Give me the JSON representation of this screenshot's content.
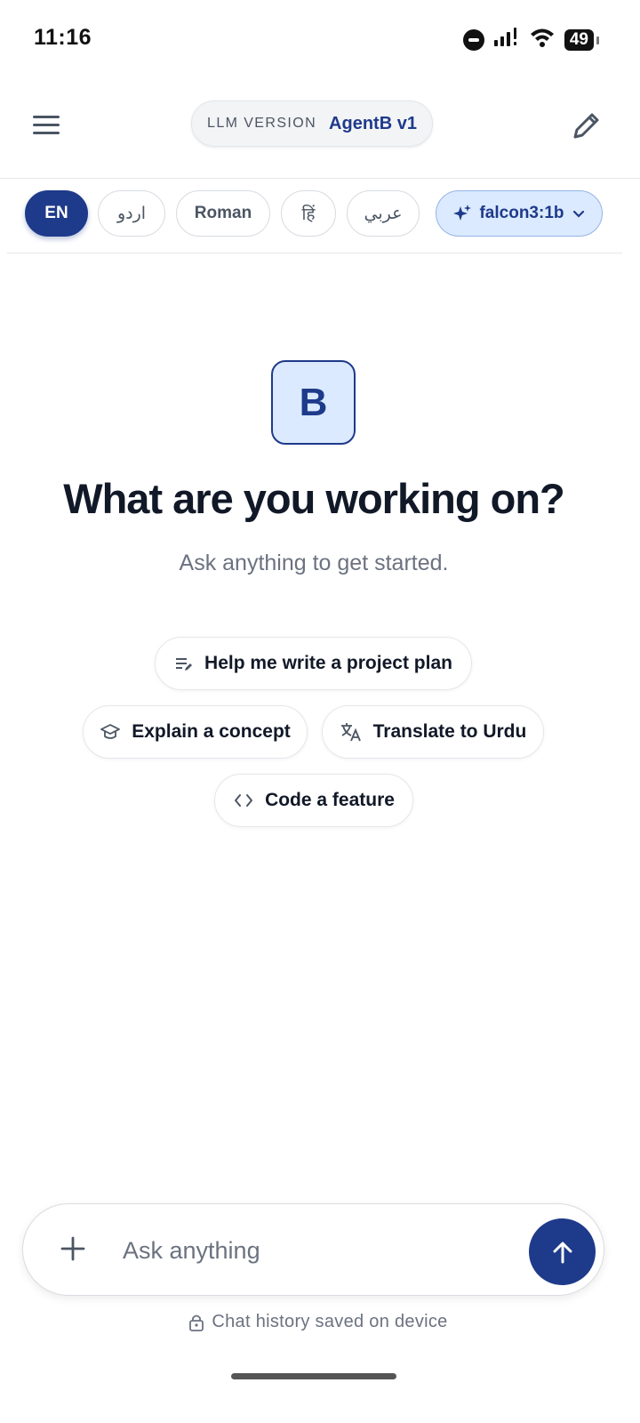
{
  "status_bar": {
    "time": "11:16",
    "battery": "49",
    "icons": [
      "do-not-disturb-icon",
      "signal-icon",
      "wifi-icon",
      "battery-icon"
    ]
  },
  "header": {
    "version_label": "LLM VERSION",
    "version_name": "AgentB v1",
    "menu_icon": "hamburger-menu-icon",
    "edit_icon": "pencil-icon"
  },
  "languages": {
    "items": [
      {
        "label": "EN",
        "active": true
      },
      {
        "label": "اردو",
        "active": false
      },
      {
        "label": "Roman",
        "active": false
      },
      {
        "label": "हिं",
        "active": false
      },
      {
        "label": "عربي",
        "active": false
      }
    ],
    "model": {
      "label": "falcon3:1b",
      "icon": "sparkle-icon"
    }
  },
  "hero": {
    "logo_letter": "B",
    "title": "What are you working on?",
    "subtitle": "Ask anything to get started."
  },
  "suggestions": [
    {
      "label": "Help me write a project plan",
      "icon": "notes-edit-icon"
    },
    {
      "label": "Explain a concept",
      "icon": "graduation-cap-icon"
    },
    {
      "label": "Translate to Urdu",
      "icon": "translate-icon"
    },
    {
      "label": "Code a feature",
      "icon": "code-icon"
    }
  ],
  "composer": {
    "placeholder": "Ask anything",
    "value": "",
    "note": "Chat history saved on device"
  },
  "colors": {
    "accent": "#1e3a8a",
    "accent_light": "#dbeafe",
    "muted_text": "#6b7280"
  }
}
